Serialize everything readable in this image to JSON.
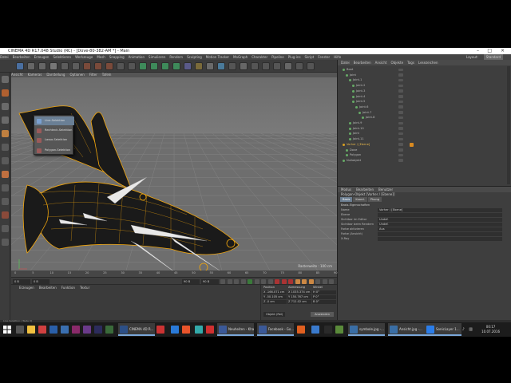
{
  "window": {
    "title": "CINEMA 4D R17.048 Studio (RC) - [Dove-80-382-AM *] - Main",
    "layout_label": "Layout:",
    "layout_value": "Standard"
  },
  "menubar": [
    "Datei",
    "Bearbeiten",
    "Erzeugen",
    "Selektieren",
    "Werkzeuge",
    "Mesh",
    "Snapping",
    "Animation",
    "Simulieren",
    "Rendern",
    "Sculpting",
    "Motion Tracker",
    "MoGraph",
    "Charakter",
    "Pipeline",
    "Plug-ins",
    "Skript",
    "Fenster",
    "Hilfe"
  ],
  "viewport": {
    "menu": [
      "Ansicht",
      "Kameras",
      "Darstellung",
      "Optionen",
      "Filter",
      "Tafeln"
    ],
    "grid_info": "Rasterweite : 100 cm"
  },
  "dropdown": {
    "items": [
      "Live-Selektion",
      "Rechteck-Selektion",
      "Lasso-Selektion",
      "Polygon-Selektion"
    ],
    "selected_index": 0
  },
  "object_manager": {
    "menu": [
      "Datei",
      "Bearbeiten",
      "Ansicht",
      "Objekte",
      "Tags",
      "Lesezeichen"
    ],
    "rows": [
      {
        "name": "Boot",
        "indent": 0
      },
      {
        "name": "Joint",
        "indent": 1
      },
      {
        "name": "Joint.1",
        "indent": 2
      },
      {
        "name": "Joint.2",
        "indent": 3
      },
      {
        "name": "Joint.3",
        "indent": 3
      },
      {
        "name": "Joint.4",
        "indent": 3
      },
      {
        "name": "Joint.5",
        "indent": 3
      },
      {
        "name": "Joint.6",
        "indent": 4
      },
      {
        "name": "Joint.7",
        "indent": 5
      },
      {
        "name": "Joint.8",
        "indent": 6
      },
      {
        "name": "Joint.9",
        "indent": 2
      },
      {
        "name": "Joint.10",
        "indent": 2
      },
      {
        "name": "Joint",
        "indent": 2
      },
      {
        "name": "Joint.11",
        "indent": 2
      },
      {
        "name": "Vorher / [Ebene]",
        "indent": 0,
        "highlight": true
      },
      {
        "name": "Dove",
        "indent": 1
      },
      {
        "name": "Polygon",
        "indent": 1
      },
      {
        "name": "Nullobjekt",
        "indent": 0
      }
    ]
  },
  "attribute_manager": {
    "menu": [
      "Modus",
      "Bearbeiten",
      "Benutzer"
    ],
    "title": "Polygon-Objekt [Vorher / [Ebene]]",
    "tabs": [
      "Basis",
      "Koord.",
      "Phong"
    ],
    "active_tab": 0,
    "section": "Basis-Eigenschaften",
    "rows": [
      {
        "key": "Name",
        "value": "Vorher / [Ebene]"
      },
      {
        "key": "Ebene",
        "value": ""
      },
      {
        "key": "Sichtbar im Editor",
        "value": "Undef."
      },
      {
        "key": "Sichtbar beim Rendern",
        "value": "Undef."
      },
      {
        "key": "Farbe aktivieren",
        "value": "Aus"
      },
      {
        "key": "Farbe (Ansicht)",
        "value": ""
      },
      {
        "key": "X-Ray",
        "value": ""
      }
    ]
  },
  "timeline": {
    "ticks": [
      "0",
      "5",
      "10",
      "15",
      "20",
      "25",
      "30",
      "35",
      "40",
      "45",
      "50",
      "55",
      "60",
      "65",
      "70",
      "75",
      "80",
      "85",
      "90"
    ],
    "current_frame": "0 B",
    "start_field": "0 B",
    "end_field": "90 B",
    "frame_right": "90 B",
    "end_label": "0 B"
  },
  "material_manager": {
    "menu": [
      "Erzeugen",
      "Bearbeiten",
      "Funktion",
      "Textur"
    ]
  },
  "coordinates": {
    "headers": [
      "Position",
      "Abmessung",
      "Winkel"
    ],
    "rows": [
      [
        "X  -166.071 cm",
        "X  1035.374 cm",
        "H  0°"
      ],
      [
        "Y  -50.105 cm",
        "Y  150.767 cm",
        "P  0°"
      ],
      [
        "Z  -0 cm",
        "Z  712.02 cm",
        "B  0°"
      ]
    ],
    "mode": "Objekt (Rel)",
    "apply": "Anwenden"
  },
  "statusbar": "Live-Selektion: [Taste 9]",
  "taskbar": {
    "apps": [
      {
        "label": "CINEMA 4D R...",
        "color": "#2c4f86"
      },
      {
        "label": "Neuheiten - Kha...",
        "color": "#3b5998"
      },
      {
        "label": "Facebook - Go...",
        "color": "#3b5998"
      },
      {
        "label": "symbole.jpg -...",
        "color": "#3a6ea5"
      },
      {
        "label": "Ansicht.jpg -...",
        "color": "#3a6ea5"
      },
      {
        "label": "SonicLayer 1...",
        "color": "#2b7de9"
      }
    ],
    "clock_time": "00:17",
    "clock_date": "10.07.2016"
  },
  "colors": {
    "accent": "#6b7d90",
    "wire": "#f2a60c",
    "viewport_bg": "#6e6e6e"
  }
}
